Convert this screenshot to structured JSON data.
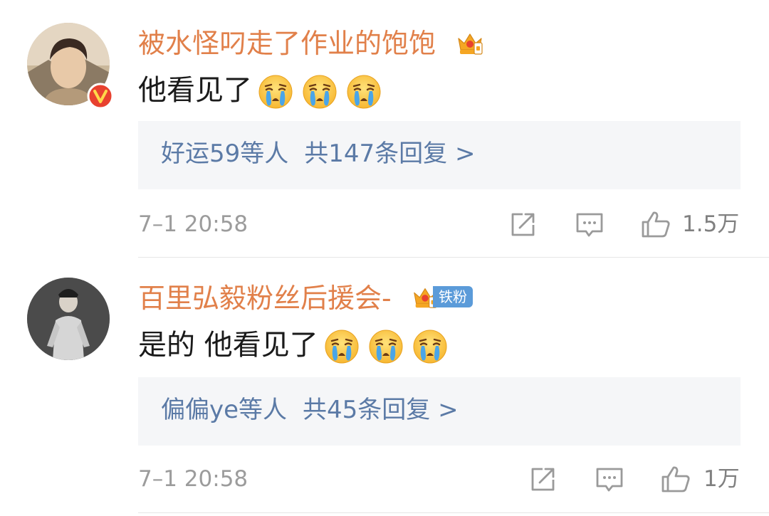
{
  "comments": [
    {
      "username": "被水怪叼走了作业的饱饱",
      "text": "他看见了",
      "emoji_icons": [
        "crying-emoji",
        "crying-emoji",
        "crying-emoji"
      ],
      "verified": true,
      "replies_preview": "好运59等人",
      "replies_total": "共147条回复 >",
      "time": "7–1 20:58",
      "likes": "1.5万"
    },
    {
      "username": "百里弘毅粉丝后援会-",
      "fan_badge": "铁粉",
      "text": "是的 他看见了",
      "emoji_icons": [
        "crying-emoji",
        "crying-emoji",
        "crying-emoji"
      ],
      "replies_preview": "偏偏ye等人",
      "replies_total": "共45条回复 >",
      "time": "7–1 20:58",
      "likes": "1万"
    }
  ],
  "colors": {
    "username": "#e1804a",
    "reply_link": "#5b7aa6",
    "meta": "#9c9c9c",
    "reply_bg": "#f5f6f8",
    "verified_badge": "#e8412f",
    "fan_badge": "#5b9bd9"
  },
  "icons": [
    "crown-icon",
    "verified-v-icon",
    "share-icon",
    "comment-icon",
    "like-thumb-icon"
  ]
}
